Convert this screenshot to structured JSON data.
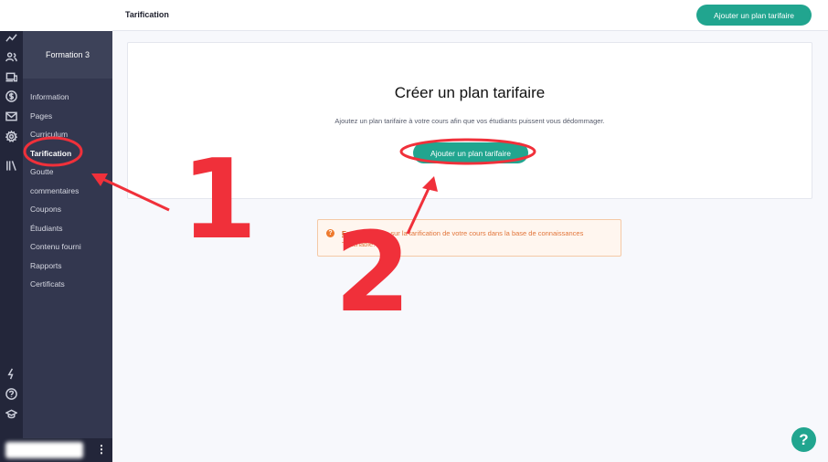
{
  "header": {
    "title": "Tarification",
    "add_button": "Ajouter un plan tarifaire"
  },
  "sidebar": {
    "course_title": "Formation 3",
    "items": [
      {
        "label": "Information"
      },
      {
        "label": "Pages"
      },
      {
        "label": "Curriculum"
      },
      {
        "label": "Tarification"
      },
      {
        "label": "Goutte"
      },
      {
        "label": "commentaires"
      },
      {
        "label": "Coupons"
      },
      {
        "label": "Étudiants"
      },
      {
        "label": "Contenu fourni"
      },
      {
        "label": "Rapports"
      },
      {
        "label": "Certificats"
      }
    ],
    "rail_icons": [
      "analytics-icon",
      "users-icon",
      "devices-icon",
      "dollar-icon",
      "mail-icon",
      "gear-icon",
      "library-icon",
      "lightning-icon",
      "help-circle-icon",
      "graduation-cap-icon"
    ]
  },
  "main": {
    "card_title": "Créer un plan tarifaire",
    "card_subtitle": "Ajoutez un plan tarifaire à votre cours afin que vos étudiants puissent vous dédommager.",
    "card_button": "Ajouter un plan tarifaire",
    "info_link": "En savoir plus",
    "info_text": "sur la tarification de votre cours dans la base de connaissances Teachable.",
    "help_symbol": "?"
  },
  "annotations": {
    "label_1": "1",
    "label_2": "2",
    "color": "#f0303a"
  },
  "colors": {
    "accent": "#21a58f",
    "sidebar": "#33374f",
    "rail": "#23263a"
  }
}
